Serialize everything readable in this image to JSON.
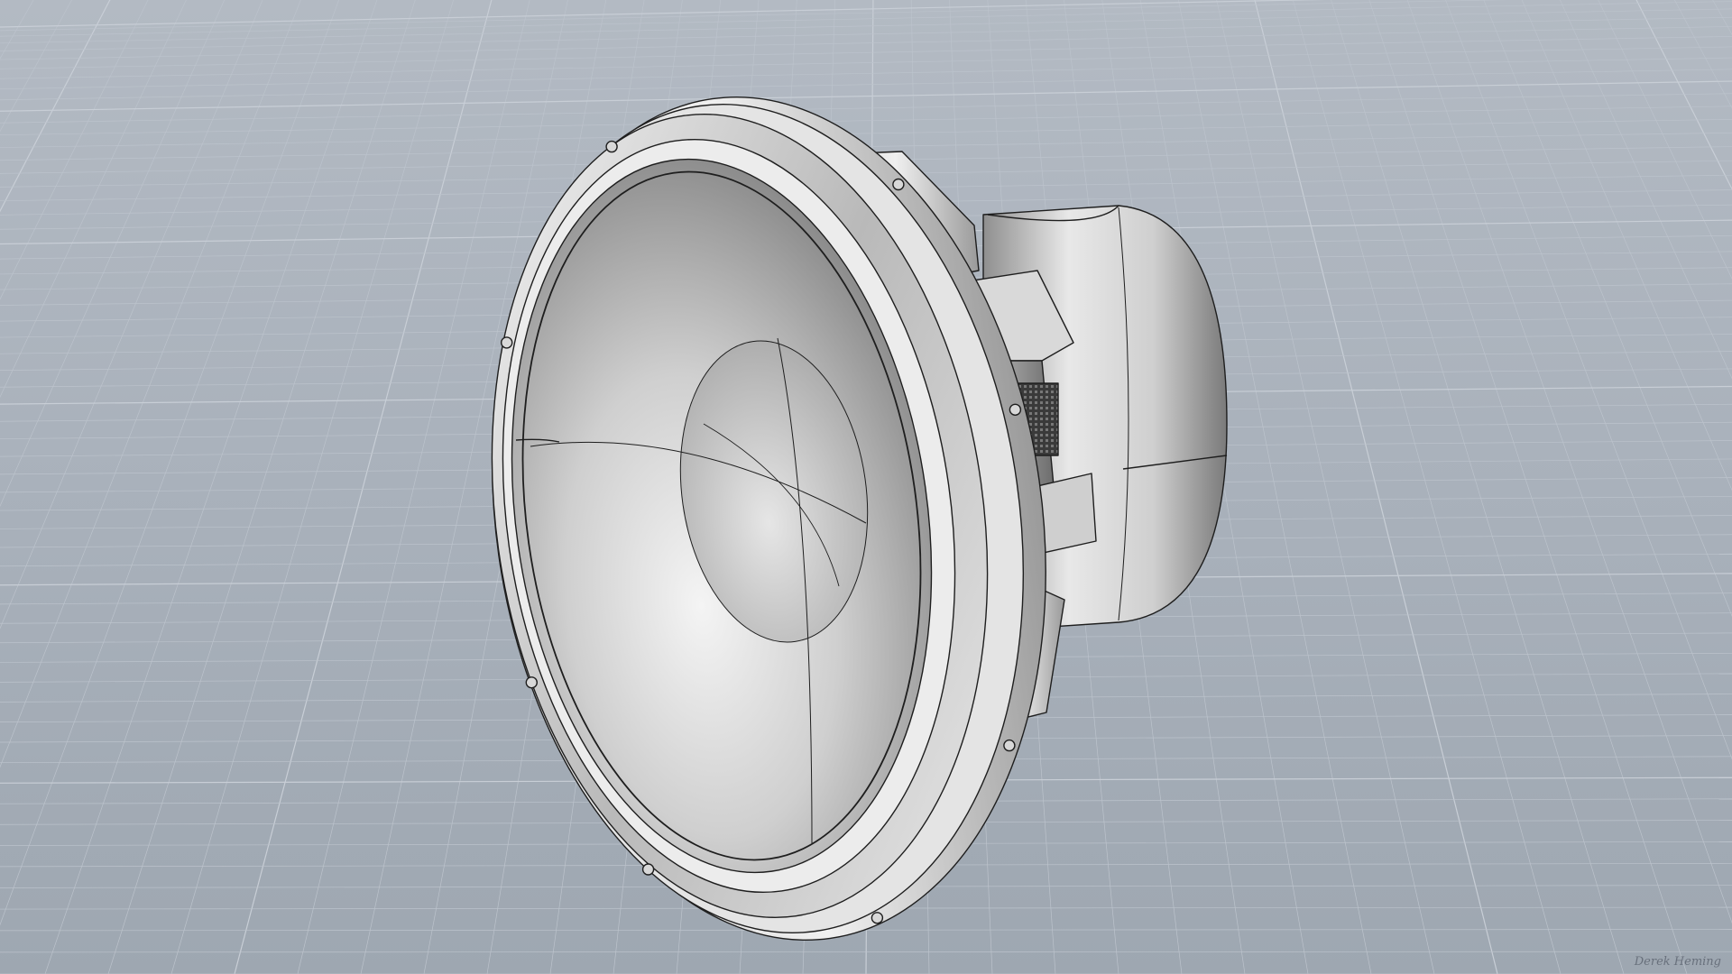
{
  "viewport": {
    "view_mode": "shaded-perspective",
    "background_color": "#a6aeb8",
    "grid_line_color": "#bcc3cc",
    "grid_major_color": "#c8ced6",
    "model_name": "",
    "model_description": ""
  },
  "model": {
    "surface_color_light": "#f2f2f2",
    "surface_color_mid": "#c9c9c9",
    "surface_color_dark": "#6e6e6e",
    "edge_color": "#1e1e1e",
    "icon": "subwoofer-driver-icon"
  },
  "signature": {
    "text": "Derek Heming"
  }
}
